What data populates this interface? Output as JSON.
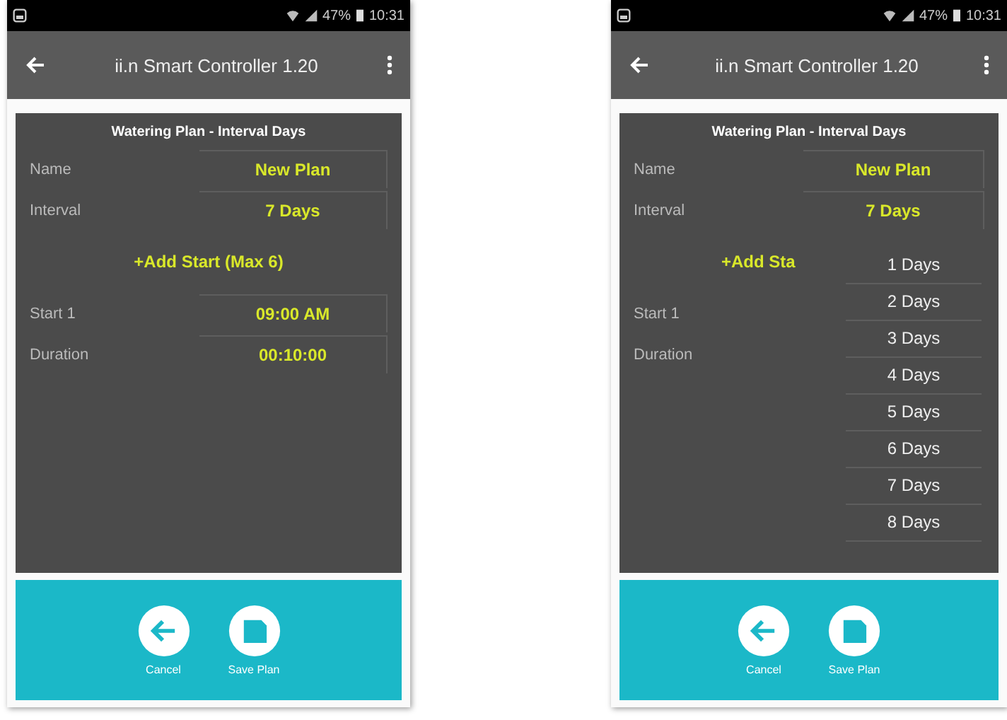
{
  "screens": [
    {
      "status_bar": {
        "battery": "47%",
        "time": "10:31"
      },
      "app_bar": {
        "title": "ii.n Smart Controller 1.20"
      },
      "form": {
        "title": "Watering Plan - Interval Days",
        "fields": [
          {
            "label": "Name",
            "value": "New Plan"
          },
          {
            "label": "Interval",
            "value": "7 Days"
          }
        ],
        "add_start": "+Add Start (Max 6)",
        "starts": [
          {
            "label": "Start 1",
            "value": "09:00 AM"
          },
          {
            "label": "Duration",
            "value": "00:10:00"
          }
        ]
      },
      "buttons": [
        {
          "kind": "back",
          "label": "Cancel"
        },
        {
          "kind": "save",
          "label": "Save Plan"
        }
      ]
    },
    {
      "status_bar": {
        "battery": "47%",
        "time": "10:31"
      },
      "app_bar": {
        "title": "ii.n Smart Controller 1.20"
      },
      "form": {
        "title": "Watering Plan - Interval Days",
        "fields": [
          {
            "label": "Name",
            "value": "New Plan"
          },
          {
            "label": "Interval",
            "value": "7 Days"
          }
        ],
        "add_start": "+Add Sta",
        "starts": [
          {
            "label": "Start 1"
          },
          {
            "label": "Duration"
          }
        ]
      },
      "dropdown": [
        "1 Days",
        "2 Days",
        "3 Days",
        "4 Days",
        "5 Days",
        "6 Days",
        "7 Days",
        "8 Days"
      ],
      "buttons": [
        {
          "kind": "back",
          "label": "Cancel"
        },
        {
          "kind": "save",
          "label": "Save Plan"
        }
      ]
    }
  ]
}
